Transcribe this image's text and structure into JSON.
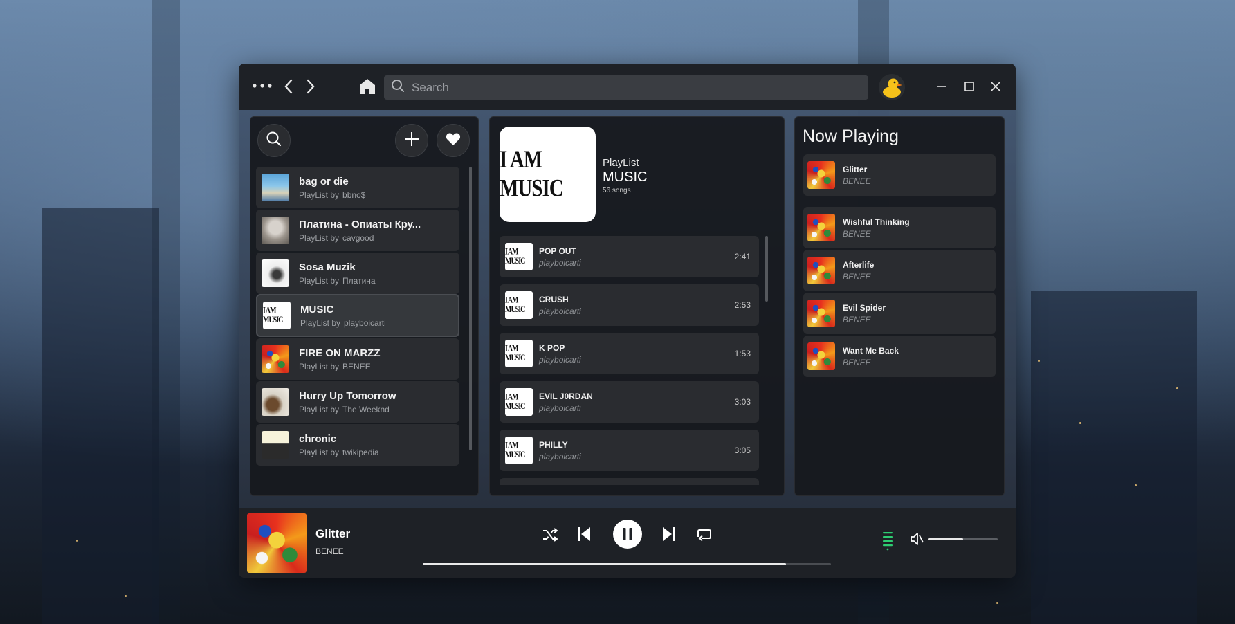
{
  "titlebar": {
    "search_placeholder": "Search",
    "icons": [
      "more-dots-icon",
      "back-arrow-icon",
      "forward-arrow-icon",
      "home-icon",
      "search-icon",
      "duck-avatar",
      "minimize-icon",
      "maximize-icon",
      "close-icon"
    ]
  },
  "library": {
    "by_label": "PlayList by",
    "items": [
      {
        "title": "bag or die",
        "owner": "bbno$",
        "art": "art-bag"
      },
      {
        "title": "Платина - Опиаты Кру...",
        "owner": "cavgood",
        "art": "art-plat"
      },
      {
        "title": "Sosa Muzik",
        "owner": "Платина",
        "art": "art-sosa"
      },
      {
        "title": "MUSIC",
        "owner": "playboicarti",
        "art": "art-iam",
        "active": true
      },
      {
        "title": "FIRE ON MARZZ",
        "owner": "BENEE",
        "art": "art-benee"
      },
      {
        "title": "Hurry Up Tomorrow",
        "owner": "The Weeknd",
        "art": "art-hurry"
      },
      {
        "title": "chronic",
        "owner": "twikipedia",
        "art": "art-chronic"
      }
    ]
  },
  "playlist": {
    "cover_text": "I AM MUSIC",
    "type": "PlayList",
    "name": "MUSIC",
    "count": "56 songs",
    "tracks": [
      {
        "title": "POP OUT",
        "artist": "playboicarti",
        "duration": "2:41"
      },
      {
        "title": "CRUSH",
        "artist": "playboicarti",
        "duration": "2:53"
      },
      {
        "title": "K POP",
        "artist": "playboicarti",
        "duration": "1:53"
      },
      {
        "title": "EVIL J0RDAN",
        "artist": "playboicarti",
        "duration": "3:03"
      },
      {
        "title": "PHILLY",
        "artist": "playboicarti",
        "duration": "3:05"
      }
    ]
  },
  "now_playing": {
    "heading": "Now Playing",
    "current": {
      "title": "Glitter",
      "artist": "BENEE"
    },
    "queue": [
      {
        "title": "Wishful Thinking",
        "artist": "BENEE"
      },
      {
        "title": "Afterlife",
        "artist": "BENEE"
      },
      {
        "title": "Evil Spider",
        "artist": "BENEE"
      },
      {
        "title": "Want Me Back",
        "artist": "BENEE"
      }
    ]
  },
  "player": {
    "title": "Glitter",
    "artist": "BENEE",
    "progress_fraction": 0.89,
    "volume_fraction": 0.5,
    "accent_color": "#2ecc71",
    "icons": [
      "shuffle-icon",
      "previous-icon",
      "pause-icon",
      "next-icon",
      "repeat-icon",
      "queue-icon",
      "volume-icon"
    ]
  }
}
